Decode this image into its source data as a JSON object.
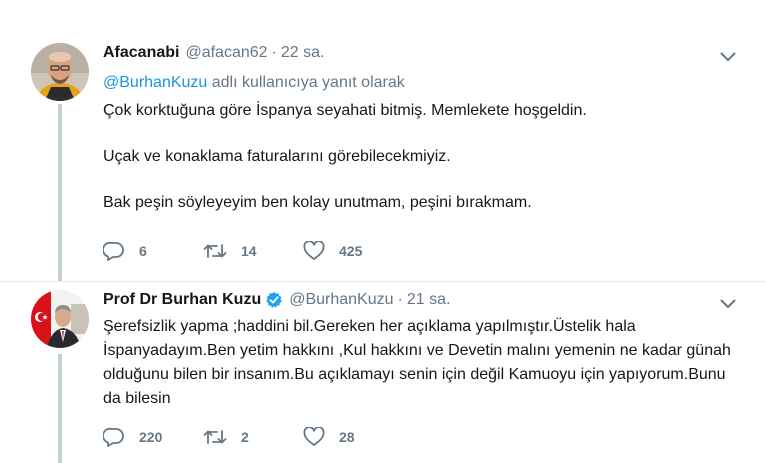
{
  "tweets": [
    {
      "display_name": "Afacanabi",
      "handle": "@afacan62",
      "dot": "·",
      "time": "22 sa.",
      "reply_mention": "@BurhanKuzu",
      "reply_suffix": " adlı kullanıcıya yanıt olarak",
      "paragraphs": [
        "Çok korktuğuna göre İspanya seyahati bitmiş. Memlekete hoşgeldin.",
        "Uçak ve konaklama faturalarını görebilecekmiyiz.",
        "Bak peşin söyleyeyim ben kolay unutmam, peşini bırakmam."
      ],
      "replies": "6",
      "retweets": "14",
      "likes": "425"
    },
    {
      "display_name": "Prof Dr Burhan Kuzu",
      "handle": "@BurhanKuzu",
      "dot": "·",
      "time": "21 sa.",
      "paragraphs": [
        "Şerefsizlik yapma ;haddini bil.Gereken her açıklama yapılmıştır.Üstelik hala İspanyadayım.Ben yetim hakkını ,Kul hakkını ve  Devetin malını yemenin ne kadar günah olduğunu bilen bir insanım.Bu açıklamayı senin için değil Kamuoyu için yapıyorum.Bunu da bilesin"
      ],
      "replies": "220",
      "retweets": "2",
      "likes": "28"
    }
  ],
  "colors": {
    "text": "#14171a",
    "secondary": "#657786",
    "link": "#1b95e0",
    "thread_line": "#c4cfd6",
    "verified": "#1da1f2"
  },
  "icons": [
    "reply-icon",
    "retweet-icon",
    "like-icon",
    "caret-down-icon",
    "verified-badge-icon"
  ]
}
